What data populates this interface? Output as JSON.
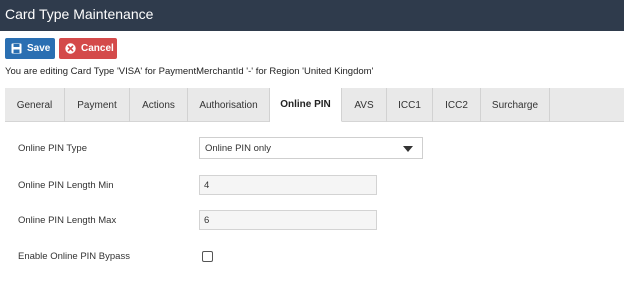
{
  "window": {
    "title": "Card Type Maintenance"
  },
  "toolbar": {
    "save_label": "Save",
    "cancel_label": "Cancel"
  },
  "edit_info": "You are editing Card Type 'VISA' for PaymentMerchantId '-' for Region 'United Kingdom'",
  "tabs": [
    {
      "label": "General",
      "active": false
    },
    {
      "label": "Payment",
      "active": false
    },
    {
      "label": "Actions",
      "active": false
    },
    {
      "label": "Authorisation",
      "active": false
    },
    {
      "label": "Online PIN",
      "active": true
    },
    {
      "label": "AVS",
      "active": false
    },
    {
      "label": "ICC1",
      "active": false
    },
    {
      "label": "ICC2",
      "active": false
    },
    {
      "label": "Surcharge",
      "active": false
    }
  ],
  "form": {
    "online_pin_type": {
      "label": "Online PIN Type",
      "value": "Online PIN only"
    },
    "pin_length_min": {
      "label": "Online PIN Length Min",
      "value": "4"
    },
    "pin_length_max": {
      "label": "Online PIN Length Max",
      "value": "6"
    },
    "pin_bypass": {
      "label": "Enable Online PIN Bypass",
      "checked": false
    }
  },
  "colors": {
    "title_bar": "#2f3b4c",
    "save_button": "#2a6fb2",
    "cancel_button": "#d44a4a",
    "tab_bar": "#e9e9e9"
  },
  "icons": {
    "save": "floppy-disk-icon",
    "cancel": "circle-x-icon",
    "dropdown": "caret-down-icon"
  }
}
